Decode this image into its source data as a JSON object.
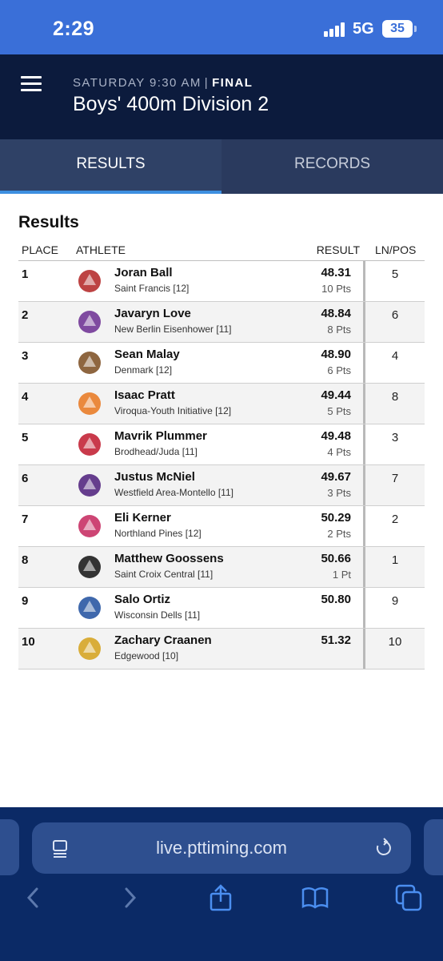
{
  "status_bar": {
    "time": "2:29",
    "network": "5G",
    "battery": "35"
  },
  "header": {
    "day_time": "SATURDAY 9:30 AM",
    "separator": "|",
    "status": "FINAL",
    "title": "Boys' 400m Division 2",
    "menu_icon": "hamburger-menu-icon"
  },
  "tabs": [
    {
      "label": "RESULTS",
      "active": true
    },
    {
      "label": "RECORDS",
      "active": false
    }
  ],
  "results": {
    "heading": "Results",
    "columns": {
      "place": "PLACE",
      "athlete": "ATHLETE",
      "result": "RESULT",
      "lane": "LN/POS"
    },
    "rows": [
      {
        "place": "1",
        "name": "Joran Ball",
        "team": "Saint Francis [12]",
        "time": "48.31",
        "points": "10 Pts",
        "lane": "5",
        "logo": "knight-logo",
        "logo_color": "#b22222"
      },
      {
        "place": "2",
        "name": "Javaryn Love",
        "team": "New Berlin Eisenhower [11]",
        "time": "48.84",
        "points": "8 Pts",
        "lane": "6",
        "logo": "lion-logo",
        "logo_color": "#6a2c91"
      },
      {
        "place": "3",
        "name": "Sean Malay",
        "team": "Denmark [12]",
        "time": "48.90",
        "points": "6 Pts",
        "lane": "4",
        "logo": "viking-logo",
        "logo_color": "#7a4b1f"
      },
      {
        "place": "4",
        "name": "Isaac Pratt",
        "team": "Viroqua-Youth Initiative [12]",
        "time": "49.44",
        "points": "5 Pts",
        "lane": "8",
        "logo": "blackhawk-logo",
        "logo_color": "#e8761c"
      },
      {
        "place": "5",
        "name": "Mavrik Plummer",
        "team": "Brodhead/Juda [11]",
        "time": "49.48",
        "points": "4 Pts",
        "lane": "3",
        "logo": "cardinal-logo",
        "logo_color": "#c0182b"
      },
      {
        "place": "6",
        "name": "Justus McNiel",
        "team": "Westfield Area-Montello [11]",
        "time": "49.67",
        "points": "3 Pts",
        "lane": "7",
        "logo": "wp-logo",
        "logo_color": "#4b1c7a"
      },
      {
        "place": "7",
        "name": "Eli Kerner",
        "team": "Northland Pines [12]",
        "time": "50.29",
        "points": "2 Pts",
        "lane": "2",
        "logo": "eagle-logo",
        "logo_color": "#c4245c"
      },
      {
        "place": "8",
        "name": "Matthew Goossens",
        "team": "Saint Croix Central [11]",
        "time": "50.66",
        "points": "1 Pt",
        "lane": "1",
        "logo": "panther-logo",
        "logo_color": "#111111"
      },
      {
        "place": "9",
        "name": "Salo Ortiz",
        "team": "Wisconsin Dells [11]",
        "time": "50.80",
        "points": "",
        "lane": "9",
        "logo": "wd-logo",
        "logo_color": "#1d4e9e"
      },
      {
        "place": "10",
        "name": "Zachary Craanen",
        "team": "Edgewood [10]",
        "time": "51.32",
        "points": "",
        "lane": "10",
        "logo": "crusader-logo",
        "logo_color": "#d4a017"
      }
    ]
  },
  "browser": {
    "url": "live.pttiming.com",
    "icons": [
      "reader-mode-icon",
      "reload-icon",
      "back-icon",
      "forward-icon",
      "share-icon",
      "bookmarks-icon",
      "tabs-icon"
    ]
  },
  "colors": {
    "status_bar": "#3a6fd8",
    "header": "#0c1b3d",
    "tabs": "#2a3a5e",
    "active_tab_underline": "#3d8fe0",
    "browser_bar": "#0b2a66"
  }
}
